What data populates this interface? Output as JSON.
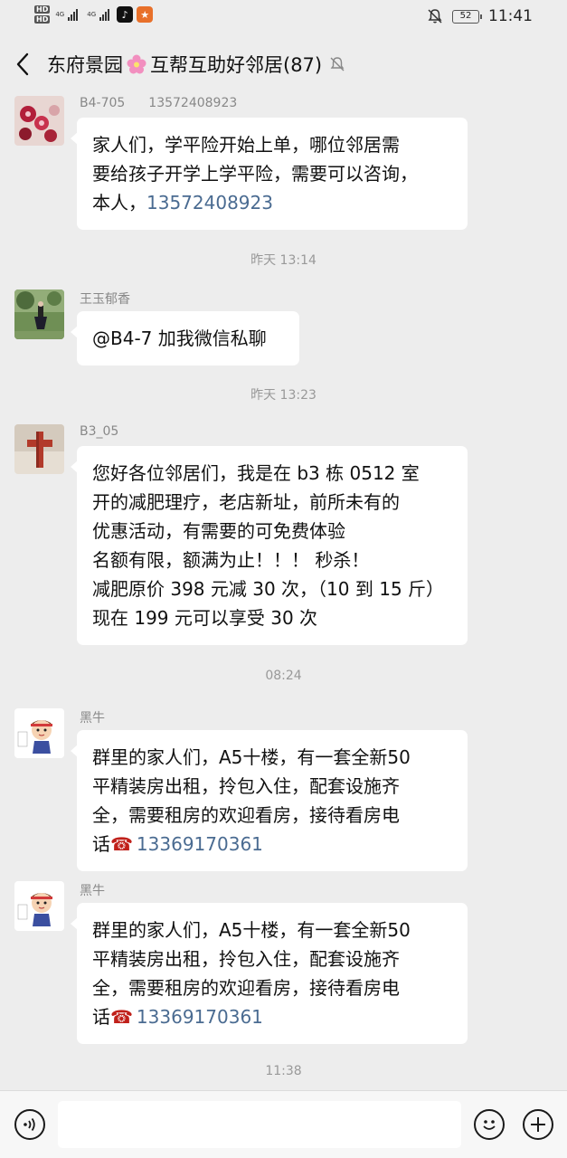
{
  "status_bar": {
    "sim1": "HD",
    "sim2": "HD",
    "net1": "4G",
    "net2": "4G",
    "battery": "52",
    "time": "11:41"
  },
  "header": {
    "group_name": "东府景园",
    "group_suffix": "互帮互助好邻居(87)"
  },
  "messages": [
    {
      "sender": "B4-705",
      "sender_phone": "13572408923",
      "lines": [
        "家人们，学平险开始上单，哪位邻居需",
        "要给孩子开学上学平险，需要可以咨询，"
      ],
      "tail_text": "本人，",
      "tail_link": "13572408923"
    },
    {
      "timestamp": "昨天 13:14"
    },
    {
      "sender": "王玉郁香",
      "text": "@B4-7 加我微信私聊"
    },
    {
      "timestamp": "昨天 13:23"
    },
    {
      "sender": "B3_05",
      "lines": [
        "您好各位邻居们，我是在 b3 栋 0512 室",
        "开的减肥理疗，老店新址，前所未有的",
        "优惠活动，有需要的可免费体验",
        "名额有限，额满为止！！！ 秒杀！",
        "减肥原价 398 元减 30 次，（10 到 15 斤）",
        "现在 199 元可以享受 30 次"
      ]
    },
    {
      "timestamp": "08:24"
    },
    {
      "sender": "黑牛",
      "lines": [
        "群里的家人们，A5十楼，有一套全新50",
        "平精装房出租，拎包入住，配套设施齐",
        "全，需要租房的欢迎看房，接待看房电"
      ],
      "tail_text": "话",
      "tail_emoji": "☎",
      "tail_link": "13369170361"
    },
    {
      "sender": "黑牛",
      "lines": [
        "群里的家人们，A5十楼，有一套全新50",
        "平精装房出租，拎包入住，配套设施齐",
        "全，需要租房的欢迎看房，接待看房电"
      ],
      "tail_text": "话",
      "tail_emoji": "☎",
      "tail_link": "13369170361"
    },
    {
      "timestamp": "11:38"
    }
  ],
  "icons": {
    "back": "chevron-left-icon",
    "mute": "bell-off-icon",
    "voice": "voice-icon",
    "emoji": "emoji-icon",
    "add": "plus-icon"
  },
  "colors": {
    "background": "#ededed",
    "bubble": "#ffffff",
    "link": "#4a6b91",
    "timestamp": "#999999"
  }
}
